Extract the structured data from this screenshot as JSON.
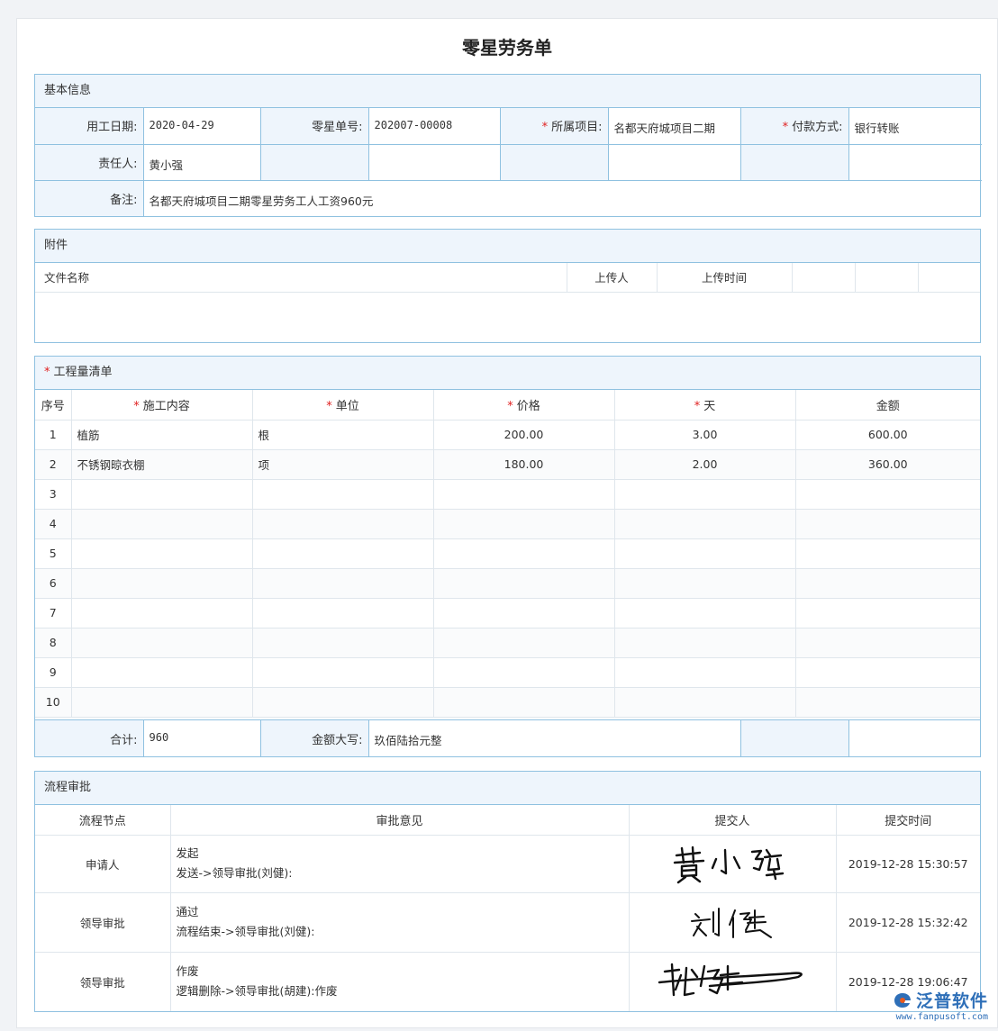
{
  "title": "零星劳务单",
  "basic": {
    "header": "基本信息",
    "work_date_label": "用工日期:",
    "work_date": "2020-04-29",
    "order_no_label": "零星单号:",
    "order_no": "202007-00008",
    "project_label": "所属项目:",
    "project": "名都天府城项目二期",
    "payment_label": "付款方式:",
    "payment": "银行转账",
    "owner_label": "责任人:",
    "owner": "黄小强",
    "remark_label": "备注:",
    "remark": "名都天府城项目二期零星劳务工人工资960元"
  },
  "attachments": {
    "header": "附件",
    "col_name": "文件名称",
    "col_uploader": "上传人",
    "col_time": "上传时间"
  },
  "items": {
    "header": "工程量清单",
    "col_no": "序号",
    "col_content": "施工内容",
    "col_unit": "单位",
    "col_price": "价格",
    "col_days": "天",
    "col_amount": "金额",
    "rows": [
      {
        "no": "1",
        "content": "植筋",
        "unit": "根",
        "price": "200.00",
        "days": "3.00",
        "amount": "600.00"
      },
      {
        "no": "2",
        "content": "不锈钢晾衣棚",
        "unit": "项",
        "price": "180.00",
        "days": "2.00",
        "amount": "360.00"
      },
      {
        "no": "3",
        "content": "",
        "unit": "",
        "price": "",
        "days": "",
        "amount": ""
      },
      {
        "no": "4",
        "content": "",
        "unit": "",
        "price": "",
        "days": "",
        "amount": ""
      },
      {
        "no": "5",
        "content": "",
        "unit": "",
        "price": "",
        "days": "",
        "amount": ""
      },
      {
        "no": "6",
        "content": "",
        "unit": "",
        "price": "",
        "days": "",
        "amount": ""
      },
      {
        "no": "7",
        "content": "",
        "unit": "",
        "price": "",
        "days": "",
        "amount": ""
      },
      {
        "no": "8",
        "content": "",
        "unit": "",
        "price": "",
        "days": "",
        "amount": ""
      },
      {
        "no": "9",
        "content": "",
        "unit": "",
        "price": "",
        "days": "",
        "amount": ""
      },
      {
        "no": "10",
        "content": "",
        "unit": "",
        "price": "",
        "days": "",
        "amount": ""
      }
    ]
  },
  "totals": {
    "total_label": "合计:",
    "total": "960",
    "uppercase_label": "金额大写:",
    "uppercase": "玖佰陆拾元整"
  },
  "flow": {
    "header": "流程审批",
    "col_node": "流程节点",
    "col_opinion": "审批意见",
    "col_submitter": "提交人",
    "col_time": "提交时间",
    "rows": [
      {
        "node": "申请人",
        "opinion": "发起",
        "detail": "发送->领导审批(刘健):",
        "signature": "黄小强",
        "time": "2019-12-28 15:30:57"
      },
      {
        "node": "领导审批",
        "opinion": "通过",
        "detail": "流程结束->领导审批(刘健):",
        "signature": "刘健",
        "time": "2019-12-28 15:32:42"
      },
      {
        "node": "领导审批",
        "opinion": "作废",
        "detail": "逻辑删除->领导审批(胡建):作废",
        "signature": "胡建",
        "time": "2019-12-28 19:06:47"
      }
    ]
  },
  "logo": {
    "text": "泛普软件",
    "url": "www.fanpusoft.com"
  }
}
